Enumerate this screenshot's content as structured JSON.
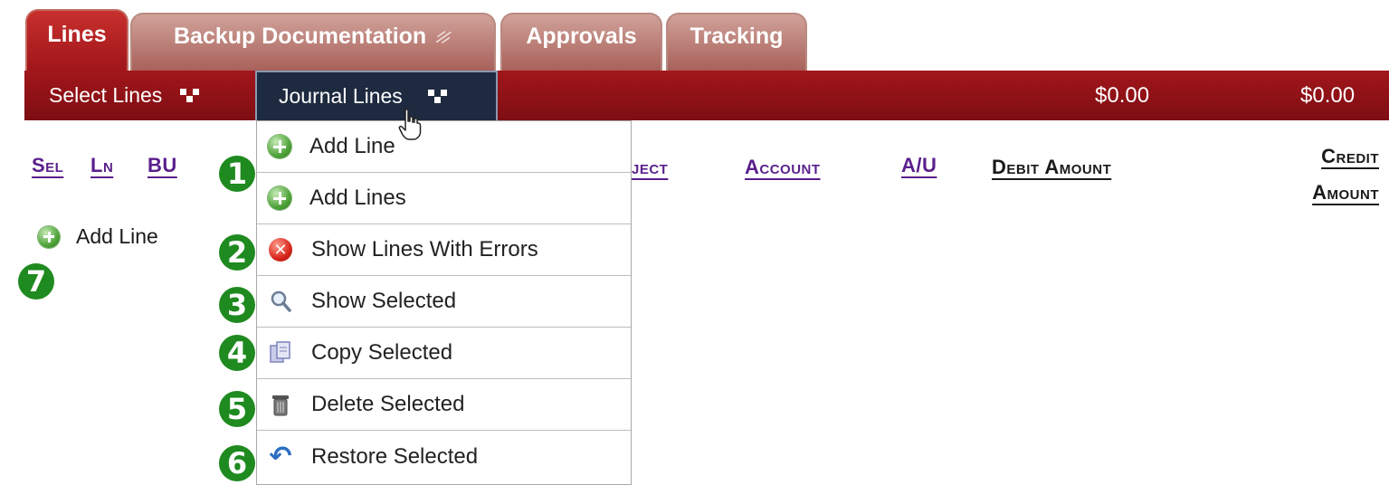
{
  "tabs": [
    {
      "label": "Lines",
      "active": true
    },
    {
      "label": "Backup Documentation",
      "icon": "paperclip-icon"
    },
    {
      "label": "Approvals"
    },
    {
      "label": "Tracking"
    }
  ],
  "menubar": {
    "select_lines": "Select Lines",
    "journal_lines": "Journal Lines",
    "total_debit": "$0.00",
    "total_credit": "$0.00"
  },
  "columns": {
    "sel": "Sel",
    "ln": "Ln",
    "bu": "BU",
    "project_partial": "ject",
    "account": "Account",
    "au": "A/U",
    "debit_amount": "Debit Amount",
    "credit_line1": "Credit",
    "credit_line2": "Amount"
  },
  "body": {
    "add_line": "Add Line"
  },
  "dropdown": {
    "items": [
      {
        "label": "Add Line",
        "icon": "add-icon"
      },
      {
        "label": "Add Lines",
        "icon": "add-icon"
      },
      {
        "label": "Show Lines With Errors",
        "icon": "error-icon"
      },
      {
        "label": "Show Selected",
        "icon": "magnifier-icon"
      },
      {
        "label": "Copy Selected",
        "icon": "copy-icon"
      },
      {
        "label": "Delete Selected",
        "icon": "trash-icon"
      },
      {
        "label": "Restore Selected",
        "icon": "undo-icon"
      }
    ]
  },
  "badges": [
    "1",
    "2",
    "3",
    "4",
    "5",
    "6",
    "7"
  ],
  "colors": {
    "menubar": "#8b1116",
    "tab_active": "#b01d21",
    "tab_inactive": "#b87a72",
    "link": "#5a1f8c",
    "badge": "#1f8a1f",
    "open_menu": "#1d2a3f"
  }
}
